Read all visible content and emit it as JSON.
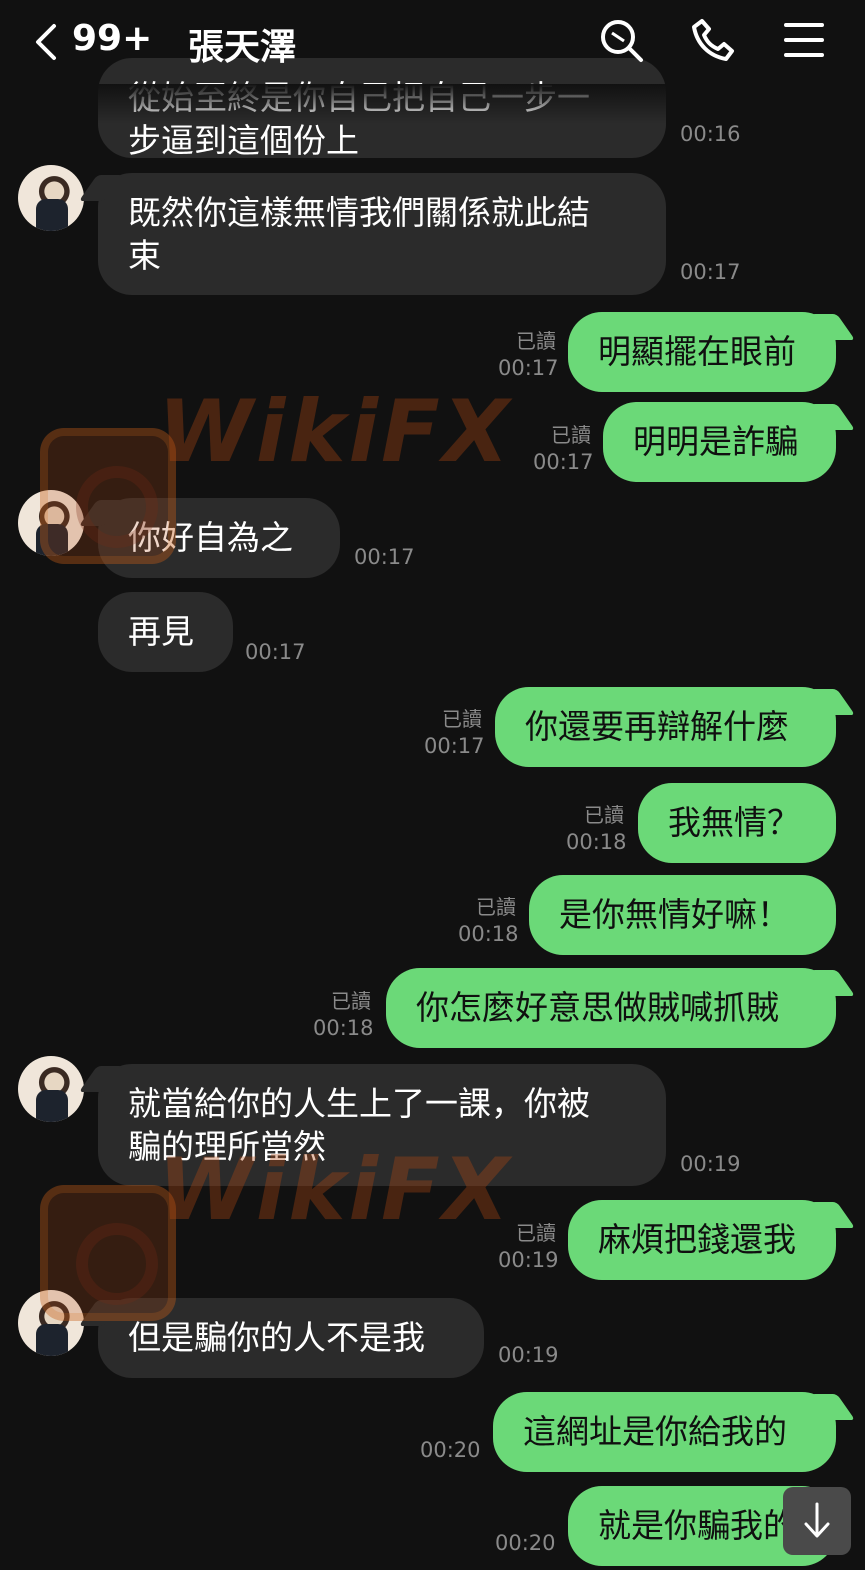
{
  "header": {
    "unread_count": "99+",
    "contact_name": "張天澤",
    "icons": [
      "back-icon",
      "search-icon",
      "phone-icon",
      "menu-icon"
    ]
  },
  "messages": [
    {
      "side": "in",
      "text": "從始至終是你自己把自己一步一\n步逼到這個份上",
      "time": "00:16"
    },
    {
      "side": "in",
      "text": "既然你這樣無情我們關係就此結\n束",
      "time": "00:17"
    },
    {
      "side": "out",
      "text": "明顯擺在眼前",
      "time": "00:17",
      "read": "已讀"
    },
    {
      "side": "out",
      "text": "明明是詐騙",
      "time": "00:17",
      "read": "已讀"
    },
    {
      "side": "in",
      "text": "你好自為之",
      "time": "00:17"
    },
    {
      "side": "in",
      "text": "再見",
      "time": "00:17"
    },
    {
      "side": "out",
      "text": "你還要再辯解什麼",
      "time": "00:17",
      "read": "已讀"
    },
    {
      "side": "out",
      "text": "我無情？",
      "time": "00:18",
      "read": "已讀"
    },
    {
      "side": "out",
      "text": "是你無情好嘛！",
      "time": "00:18",
      "read": "已讀"
    },
    {
      "side": "out",
      "text": "你怎麼好意思做賊喊抓賊",
      "time": "00:18",
      "read": "已讀"
    },
    {
      "side": "in",
      "text": "就當給你的人生上了一課，你被\n騙的理所當然",
      "time": "00:19"
    },
    {
      "side": "out",
      "text": "麻煩把錢還我",
      "time": "00:19",
      "read": "已讀"
    },
    {
      "side": "in",
      "text": "但是騙你的人不是我",
      "time": "00:19"
    },
    {
      "side": "out",
      "text": "這網址是你給我的",
      "time": "00:20"
    },
    {
      "side": "out",
      "text": "就是你騙我的",
      "time": "00:20"
    }
  ],
  "watermark": {
    "text": "WikiFX"
  },
  "colors": {
    "background": "#111111",
    "incoming": "#2b2b2b",
    "outgoing": "#6bd978",
    "meta": "#8a8a8a"
  }
}
